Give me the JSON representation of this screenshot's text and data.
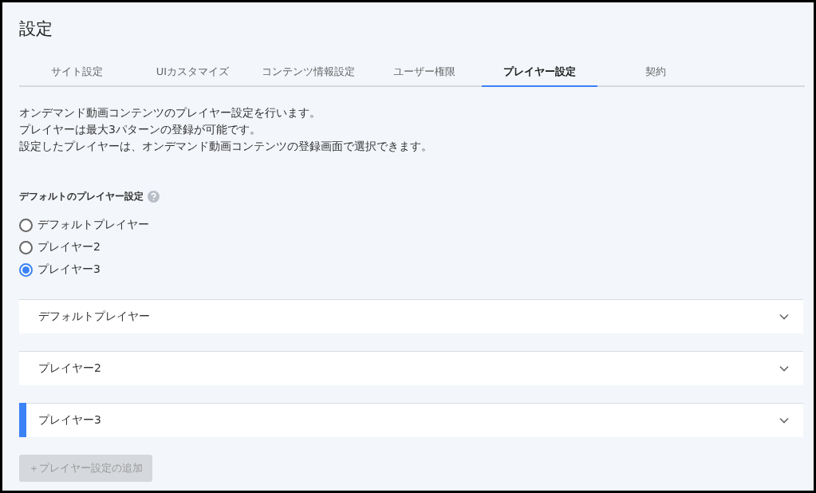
{
  "title": "設定",
  "tabs": [
    {
      "label": "サイト設定",
      "selected": false
    },
    {
      "label": "UIカスタマイズ",
      "selected": false
    },
    {
      "label": "コンテンツ情報設定",
      "selected": false
    },
    {
      "label": "ユーザー権限",
      "selected": false
    },
    {
      "label": "プレイヤー設定",
      "selected": true
    },
    {
      "label": "契約",
      "selected": false
    }
  ],
  "description": [
    "オンデマンド動画コンテンツのプレイヤー設定を行います。",
    "プレイヤーは最大3パターンの登録が可能です。",
    "設定したプレイヤーは、オンデマンド動画コンテンツの登録画面で選択できます。"
  ],
  "default_setting": {
    "label": "デフォルトのプレイヤー設定",
    "options": [
      {
        "label": "デフォルトプレイヤー",
        "selected": false
      },
      {
        "label": "プレイヤー2",
        "selected": false
      },
      {
        "label": "プレイヤー3",
        "selected": true
      }
    ]
  },
  "players": [
    {
      "name": "デフォルトプレイヤー",
      "highlighted": false,
      "expanded": false
    },
    {
      "name": "プレイヤー2",
      "highlighted": false,
      "expanded": false
    },
    {
      "name": "プレイヤー3",
      "highlighted": true,
      "expanded": false
    }
  ],
  "add_button": {
    "label": "＋プレイヤー設定の追加",
    "disabled": true
  }
}
